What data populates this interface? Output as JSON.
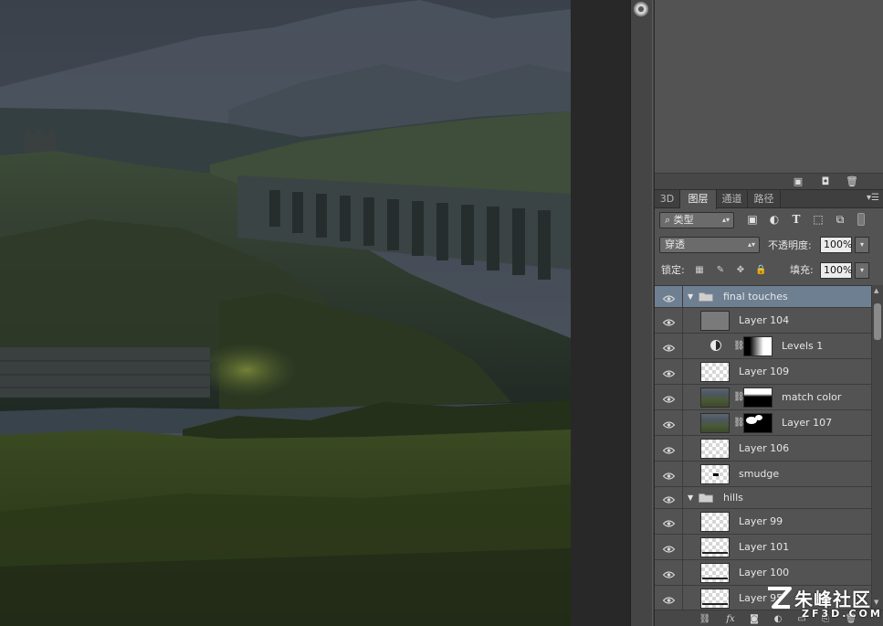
{
  "panel_tabs": [
    {
      "label": "3D"
    },
    {
      "label": "图层"
    },
    {
      "label": "通道"
    },
    {
      "label": "路径"
    }
  ],
  "filter": {
    "kind_label": "类型",
    "icons": [
      "image-filter-icon",
      "adjustment-filter-icon",
      "type-filter-icon",
      "shape-filter-icon",
      "smart-object-filter-icon",
      "filter-toggle-icon"
    ]
  },
  "blend": {
    "mode": "穿透",
    "opacity_label": "不透明度:",
    "opacity_value": "100%"
  },
  "lock": {
    "label": "锁定:",
    "fill_label": "填充:",
    "fill_value": "100%"
  },
  "layers": [
    {
      "name": "final touches",
      "type": "group",
      "expanded": true,
      "selected": true,
      "indent": 0
    },
    {
      "name": "Layer 104",
      "type": "layer",
      "thumb": "gray",
      "indent": 1
    },
    {
      "name": "Levels 1",
      "type": "adjustment",
      "mask": "gradient",
      "indent": 1
    },
    {
      "name": "Layer 109",
      "type": "layer",
      "thumb": "checker",
      "indent": 1
    },
    {
      "name": "match color",
      "type": "layer-mask",
      "thumb": "photo",
      "mask": "black-white-bottom",
      "indent": 1
    },
    {
      "name": "Layer 107",
      "type": "layer-mask",
      "thumb": "photo",
      "mask": "blobs",
      "indent": 1
    },
    {
      "name": "Layer 106",
      "type": "layer",
      "thumb": "checker",
      "indent": 1
    },
    {
      "name": "smudge",
      "type": "layer",
      "thumb": "checker",
      "indent": 1
    },
    {
      "name": "hills",
      "type": "group",
      "expanded": true,
      "selected": false,
      "indent": 0
    },
    {
      "name": "Layer 99",
      "type": "layer",
      "thumb": "checker",
      "indent": 1
    },
    {
      "name": "Layer 101",
      "type": "layer",
      "thumb": "checker",
      "indent": 1
    },
    {
      "name": "Layer 100",
      "type": "layer",
      "thumb": "checker",
      "indent": 1
    },
    {
      "name": "Layer 95",
      "type": "layer",
      "thumb": "checker",
      "indent": 1
    }
  ],
  "footer_icons": [
    "link-icon",
    "fx-icon",
    "add-mask-icon",
    "new-adjustment-icon",
    "new-group-icon",
    "new-layer-icon",
    "delete-icon"
  ],
  "watermark": {
    "cn": "朱峰社区",
    "en": "ZF3D.COM"
  },
  "colors": {
    "selected_row": "#6f7f92",
    "panel_bg": "#535353"
  }
}
